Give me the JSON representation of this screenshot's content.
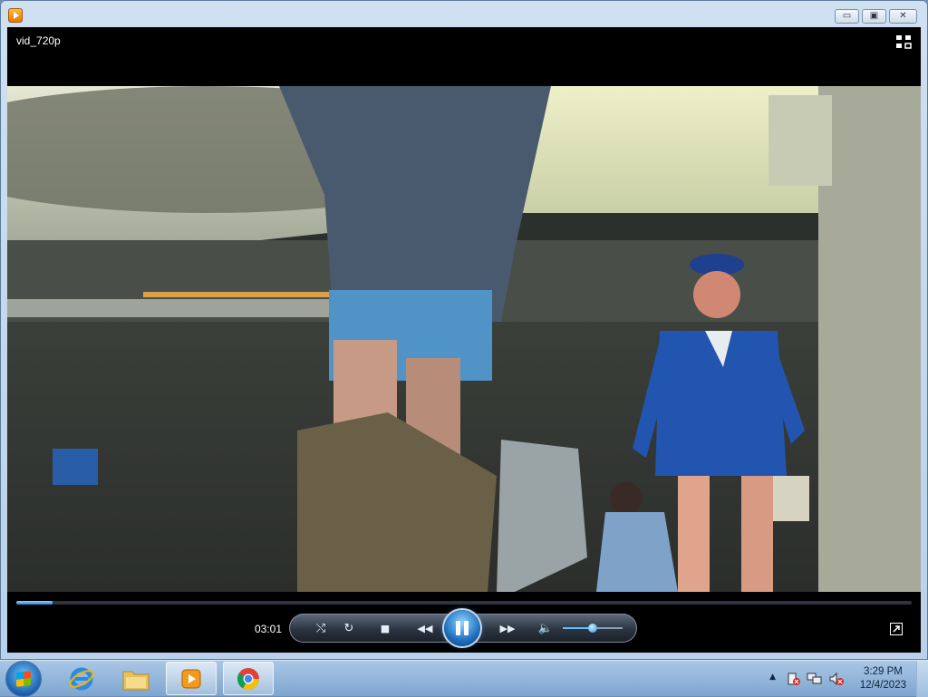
{
  "window": {
    "title_icon": "media-player-icon",
    "buttons": {
      "minimize": "▭",
      "maximize": "▣",
      "close": "✕"
    }
  },
  "player": {
    "media_title": "vid_720p",
    "current_time": "03:01",
    "progress": 0.04,
    "volume": 0.5,
    "icons": {
      "switch_to_library": "switch-to-library-icon",
      "shuffle": "shuffle-icon",
      "repeat": "repeat-icon",
      "stop": "stop-icon",
      "previous": "previous-icon",
      "pause": "pause-icon",
      "next": "next-icon",
      "mute": "speaker-icon",
      "fullscreen": "fullscreen-icon"
    },
    "glyphs": {
      "shuffle": "⤭",
      "repeat": "↻",
      "stop": "■",
      "previous": "◀◀",
      "next": "▶▶",
      "mute": "🔈"
    }
  },
  "taskbar": {
    "items": [
      "start",
      "internet-explorer",
      "file-explorer",
      "windows-media-player",
      "google-chrome"
    ],
    "tray": {
      "time": "3:29 PM",
      "date": "12/4/2023"
    }
  },
  "colors": {
    "accent": "#2a86d6",
    "taskbar": "#7ea6cf",
    "window_frame": "#b9d1ea"
  }
}
